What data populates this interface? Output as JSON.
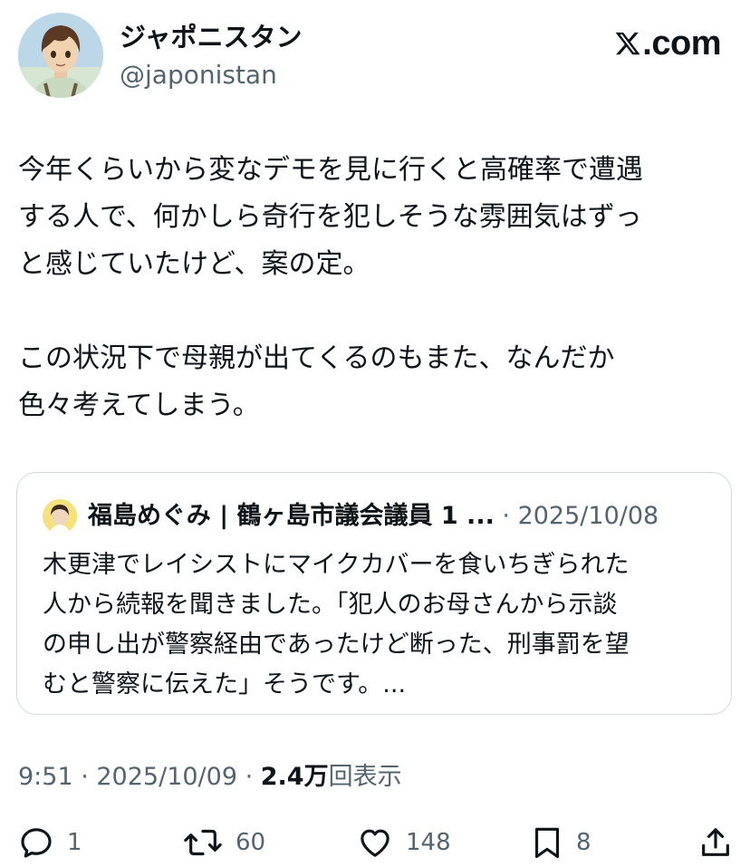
{
  "author": {
    "display_name": "ジャポニスタン",
    "handle": "@japonistan",
    "avatar": "anime-boy-avatar"
  },
  "brand": {
    "label": ".com",
    "logo": "x-logo-icon"
  },
  "tweet": {
    "text": "今年くらいから変なデモを見に行くと高確率で遭遇\nする人で、何かしら奇行を犯しそうな雰囲気はずっ\nと感じていたけど、案の定。\n\nこの状況下で母親が出てくるのもまた、なんだか\n色々考えてしまう。"
  },
  "quote": {
    "author_name": "福島めぐみ | 鶴ヶ島市議会議員 1 ...",
    "separator": " · ",
    "date": "2025/10/08",
    "text": "木更津でレイシストにマイクカバーを食いちぎられた\n人から続報を聞きました。「犯人のお母さんから示談\nの申し出が警察経由であったけど断った、刑事罰を望\nむと警察に伝えた」そうです。..."
  },
  "meta": {
    "timestamp": "9:51 · 2025/10/09 · ",
    "views_count": "2.4万",
    "views_label": "回表示"
  },
  "actions": {
    "reply_count": "1",
    "retweet_count": "60",
    "like_count": "148",
    "bookmark_count": "8"
  },
  "colors": {
    "text": "#0f1419",
    "secondary": "#536471",
    "border": "#cfd9de"
  }
}
